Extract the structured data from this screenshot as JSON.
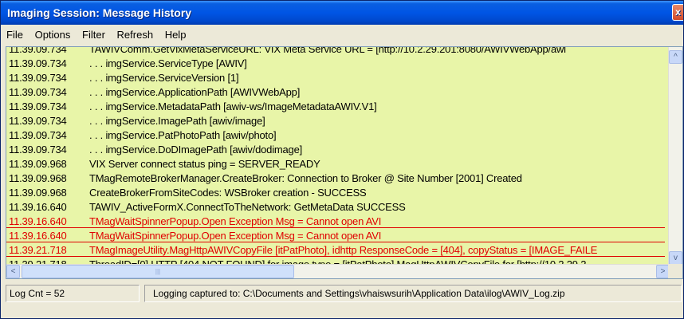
{
  "window": {
    "title": "Imaging Session:  Message History",
    "close_glyph": "x"
  },
  "menu": [
    "File",
    "Options",
    "Filter",
    "Refresh",
    "Help"
  ],
  "log_lines": [
    {
      "ts": "11.39.09.734",
      "msg": "TAWIVComm.GetVixMetaServiceURL: VIX Meta Service URL = [http://10.2.29.201:8080/AWIVWebApp/awi",
      "error": false
    },
    {
      "ts": "11.39.09.734",
      "msg": ". . . imgService.ServiceType [AWIV]",
      "error": false
    },
    {
      "ts": "11.39.09.734",
      "msg": ". . . imgService.ServiceVersion [1]",
      "error": false
    },
    {
      "ts": "11.39.09.734",
      "msg": ". . . imgService.ApplicationPath [AWIVWebApp]",
      "error": false
    },
    {
      "ts": "11.39.09.734",
      "msg": ". . . imgService.MetadataPath [awiv-ws/ImageMetadataAWIV.V1]",
      "error": false
    },
    {
      "ts": "11.39.09.734",
      "msg": ". . . imgService.ImagePath [awiv/image]",
      "error": false
    },
    {
      "ts": "11.39.09.734",
      "msg": ". . . imgService.PatPhotoPath [awiv/photo]",
      "error": false
    },
    {
      "ts": "11.39.09.734",
      "msg": ". . . imgService.DoDImagePath [awiv/dodimage]",
      "error": false
    },
    {
      "ts": "11.39.09.968",
      "msg": "VIX Server connect status ping = SERVER_READY",
      "error": false
    },
    {
      "ts": "11.39.09.968",
      "msg": "TMagRemoteBrokerManager.CreateBroker: Connection to Broker @ Site Number [2001] Created",
      "error": false
    },
    {
      "ts": "11.39.09.968",
      "msg": "CreateBrokerFromSiteCodes: WSBroker creation - SUCCESS",
      "error": false
    },
    {
      "ts": "11.39.16.640",
      "msg": "TAWIV_ActiveFormX.ConnectToTheNetwork: GetMetaData SUCCESS",
      "error": false
    },
    {
      "ts": "11.39.16.640",
      "msg": "TMagWaitSpinnerPopup.Open Exception Msg = Cannot open AVI",
      "error": true
    },
    {
      "ts": "11.39.16.640",
      "msg": "TMagWaitSpinnerPopup.Open Exception Msg = Cannot open AVI",
      "error": true
    },
    {
      "ts": "11.39.21.718",
      "msg": "TMagImageUtility.MagHttpAWIVCopyFile [itPatPhoto], idhttp ResponseCode = [404], copyStatus = [IMAGE_FAILE",
      "error": true
    },
    {
      "ts": "11.39.21.718",
      "msg": "ThreadID=[0] HTTP [404 NOT FOUND] for image type = [itPatPhoto] MagHttpAWIVCopyFile for [http://10.2.29.2",
      "error": false
    }
  ],
  "scroll": {
    "up": "^",
    "down": "v",
    "left": "<",
    "right": ">",
    "grip": "|||"
  },
  "status": {
    "count": "Log Cnt = 52",
    "message": "Logging captured to: C:\\Documents and Settings\\vhaiswsurih\\Application Data\\ilog\\AWIV_Log.zip"
  }
}
